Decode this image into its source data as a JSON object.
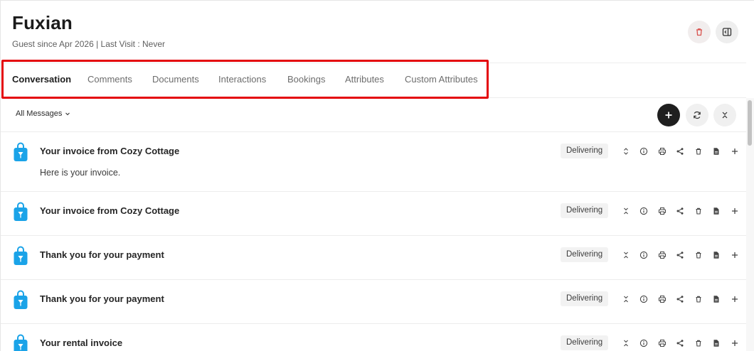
{
  "guest": {
    "name": "Fuxian",
    "meta": "Guest since Apr 2026 | Last Visit : Never"
  },
  "header_actions": [
    {
      "name": "delete-icon",
      "color": "#d9534f"
    },
    {
      "name": "sidebar-panel-icon",
      "color": "#333333"
    }
  ],
  "tabs": [
    {
      "label": "Conversation",
      "active": true
    },
    {
      "label": "Comments",
      "active": false
    },
    {
      "label": "Documents",
      "active": false
    },
    {
      "label": "Interactions",
      "active": false
    },
    {
      "label": "Bookings",
      "active": false
    },
    {
      "label": "Attributes",
      "active": false
    },
    {
      "label": "Custom Attributes",
      "active": false
    }
  ],
  "toolbar": {
    "filter_label": "All Messages",
    "filter_icon": "chevron-down-icon",
    "buttons": [
      "plus-icon",
      "refresh-icon",
      "collapse-all-icon"
    ]
  },
  "messages": [
    {
      "subject": "Your invoice from Cozy Cottage",
      "preview": "Here is your invoice.",
      "status": "Delivering",
      "expanded": true
    },
    {
      "subject": "Your invoice from Cozy Cottage",
      "preview": "",
      "status": "Delivering",
      "expanded": false
    },
    {
      "subject": "Thank you for your payment",
      "preview": "",
      "status": "Delivering",
      "expanded": false
    },
    {
      "subject": "Thank you for your payment",
      "preview": "",
      "status": "Delivering",
      "expanded": false
    },
    {
      "subject": "Your rental invoice",
      "preview": "",
      "status": "Delivering",
      "expanded": false
    }
  ],
  "message_actions": [
    "expand-toggle-icon",
    "info-icon",
    "print-icon",
    "share-icon",
    "delete-icon",
    "document-icon",
    "plus-icon"
  ],
  "colors": {
    "accent_highlight": "#e4050b",
    "bag_icon": "#1aa3e8",
    "primary_button": "#1f1f1f"
  }
}
